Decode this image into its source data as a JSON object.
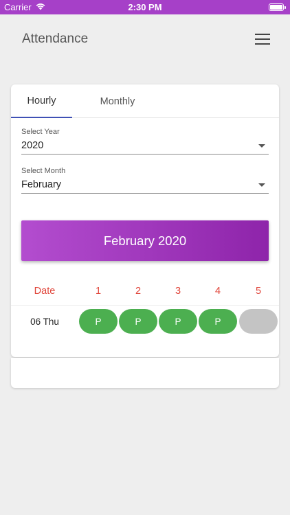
{
  "status_bar": {
    "carrier": "Carrier",
    "time": "2:30 PM"
  },
  "app_bar": {
    "title": "Attendance"
  },
  "tabs": [
    {
      "label": "Hourly"
    },
    {
      "label": "Monthly"
    }
  ],
  "year_field": {
    "label": "Select Year",
    "value": "2020"
  },
  "month_field": {
    "label": "Select Month",
    "value": "February"
  },
  "banner": {
    "text": "February 2020"
  },
  "table": {
    "date_header": "Date",
    "period_headers": [
      "1",
      "2",
      "3",
      "4",
      "5"
    ],
    "rows": [
      {
        "date": "06 Thu",
        "statuses": [
          "P",
          "P",
          "P",
          "P",
          ""
        ]
      }
    ]
  },
  "colors": {
    "accent": "#a640c8",
    "present": "#4caf50",
    "empty": "#c4c4c4",
    "header_text": "#e0453a",
    "tab_indicator": "#3f51b5"
  },
  "icons": {
    "menu": "hamburger-menu-icon",
    "wifi": "wifi-icon",
    "battery": "battery-icon"
  }
}
